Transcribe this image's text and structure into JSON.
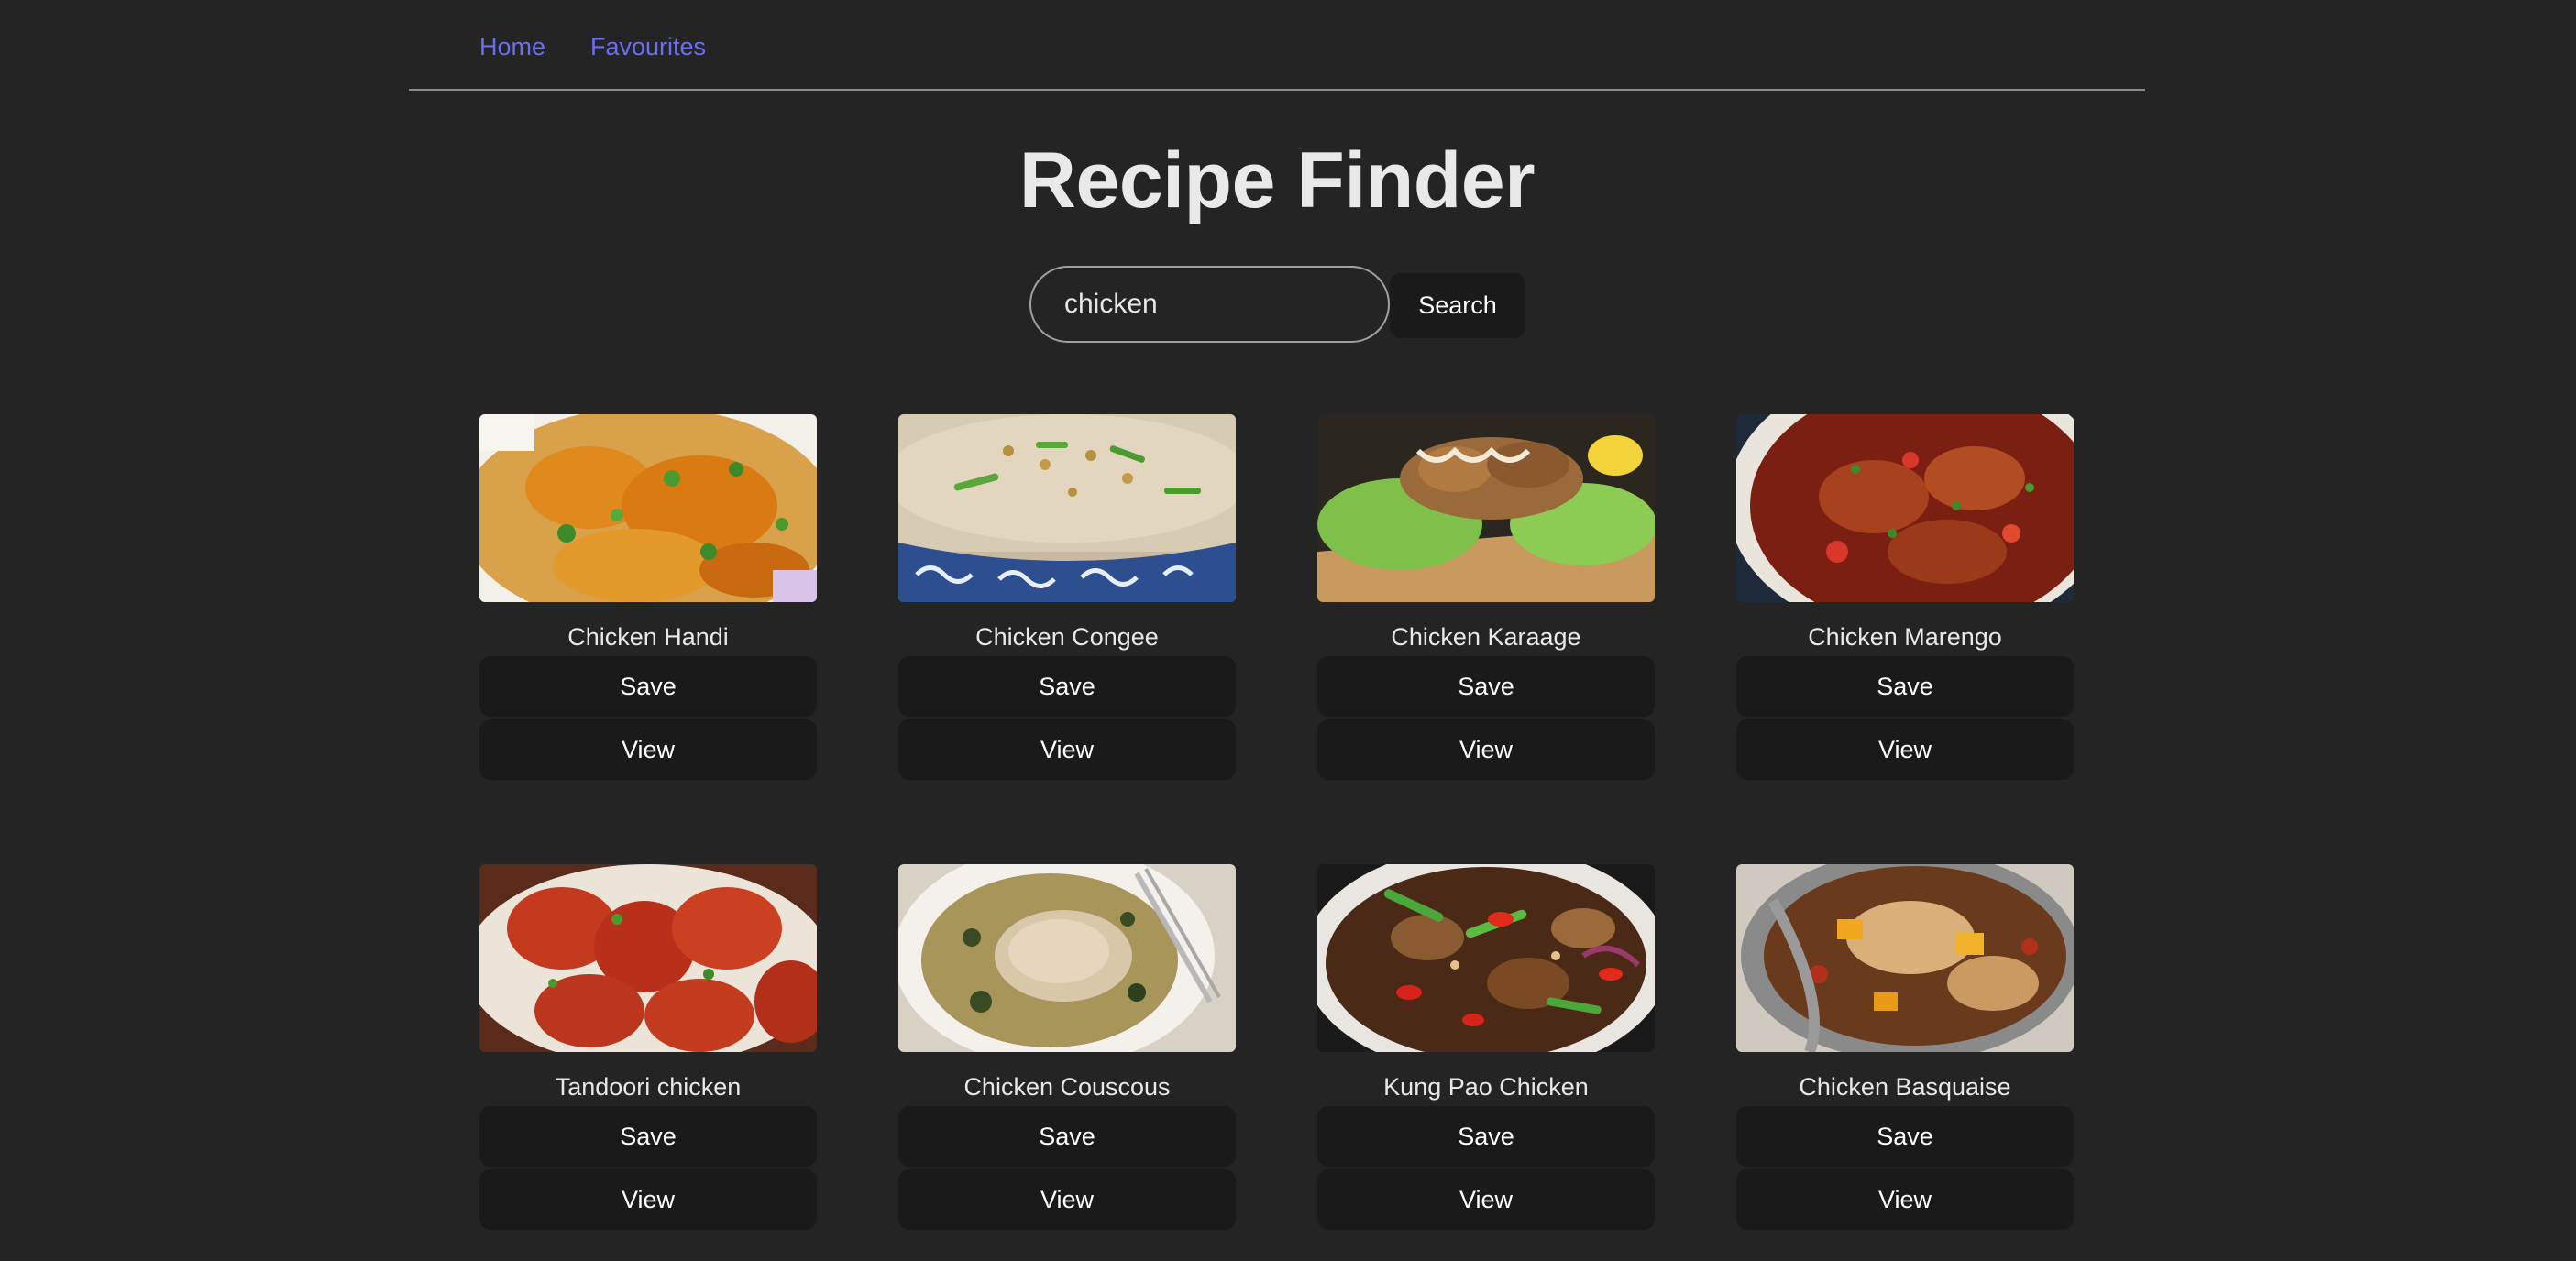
{
  "nav": {
    "home_label": "Home",
    "favourites_label": "Favourites"
  },
  "page": {
    "title": "Recipe Finder"
  },
  "search": {
    "value": "chicken",
    "button_label": "Search"
  },
  "recipes": [
    {
      "name": "Chicken Handi",
      "save_label": "Save",
      "view_label": "View",
      "image": "chicken-handi-photo"
    },
    {
      "name": "Chicken Congee",
      "save_label": "Save",
      "view_label": "View",
      "image": "chicken-congee-photo"
    },
    {
      "name": "Chicken Karaage",
      "save_label": "Save",
      "view_label": "View",
      "image": "chicken-karaage-photo"
    },
    {
      "name": "Chicken Marengo",
      "save_label": "Save",
      "view_label": "View",
      "image": "chicken-marengo-photo"
    },
    {
      "name": "Tandoori chicken",
      "save_label": "Save",
      "view_label": "View",
      "image": "tandoori-chicken-photo"
    },
    {
      "name": "Chicken Couscous",
      "save_label": "Save",
      "view_label": "View",
      "image": "chicken-couscous-photo"
    },
    {
      "name": "Kung Pao Chicken",
      "save_label": "Save",
      "view_label": "View",
      "image": "kung-pao-chicken-photo"
    },
    {
      "name": "Chicken Basquaise",
      "save_label": "Save",
      "view_label": "View",
      "image": "chicken-basquaise-photo"
    }
  ],
  "colors": {
    "background": "#242424",
    "button": "#1a1a1a",
    "link": "#6a6ff0",
    "text": "#e8e8e8"
  }
}
